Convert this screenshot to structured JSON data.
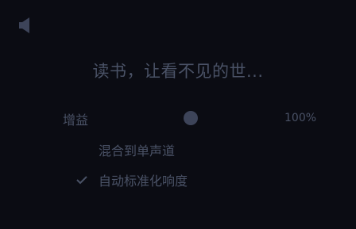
{
  "title": "读书，让看不见的世...",
  "speaker_icon": "speaker-icon",
  "gain": {
    "label": "增益",
    "value_text": "100%",
    "level_fraction": 0.5
  },
  "options": {
    "mono": {
      "label": "混合到单声道",
      "checked": false
    },
    "normalize": {
      "label": "自动标准化响度",
      "checked": true
    }
  },
  "colors": {
    "background": "#0b0c13",
    "text": "#4a5266",
    "knob": "#3d4459"
  }
}
